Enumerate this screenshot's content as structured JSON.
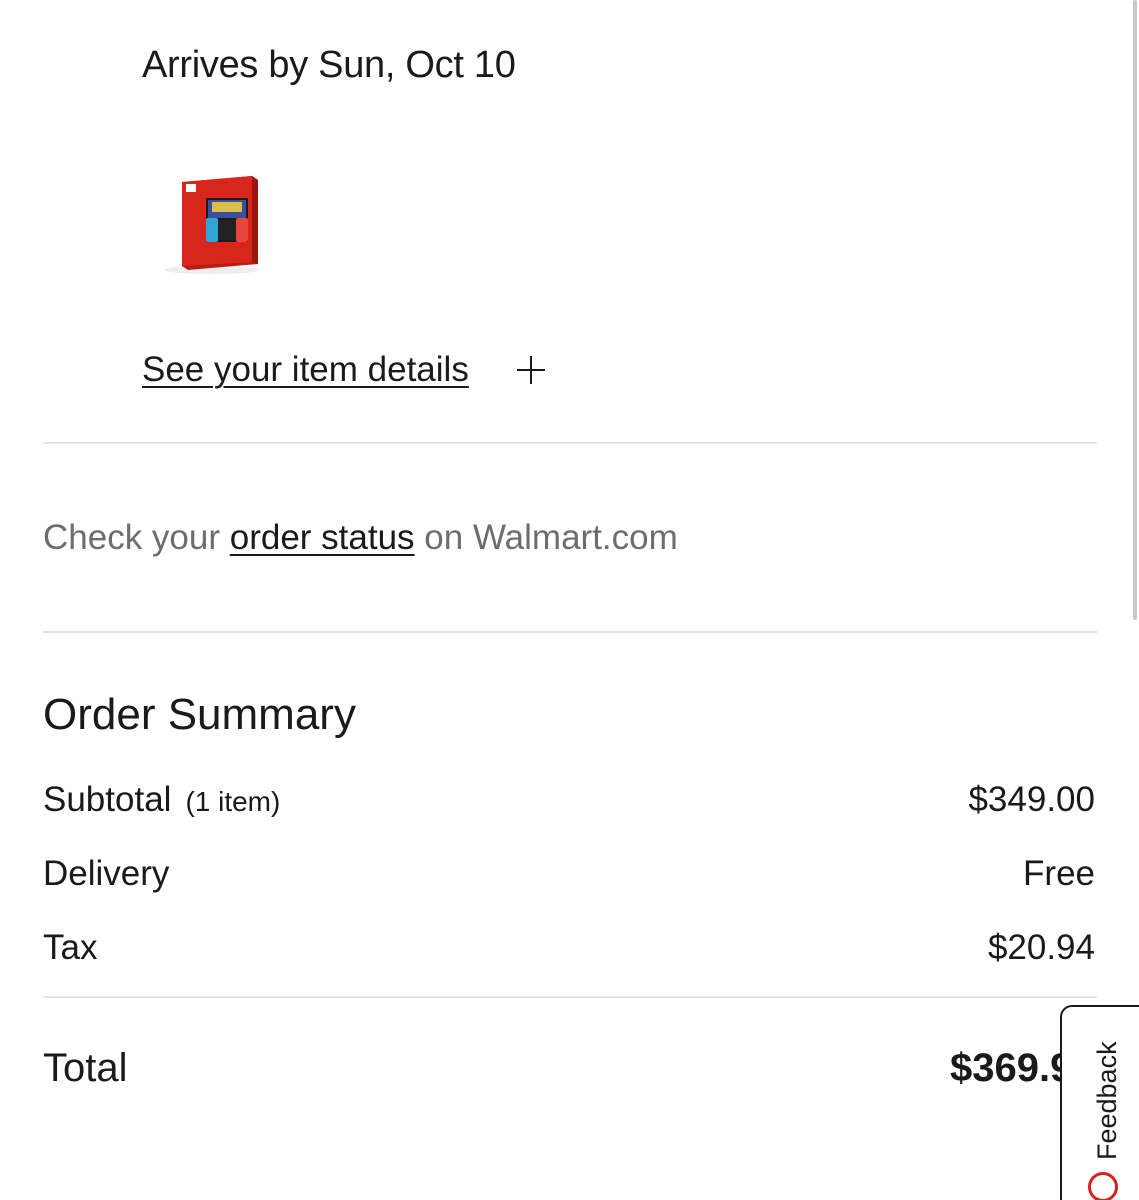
{
  "shipment": {
    "arrival_text": "Arrives by Sun, Oct 10",
    "product_image": "nintendo-switch-box-image",
    "details_link": "See your item details",
    "expand_icon": "plus-icon"
  },
  "status": {
    "prefix": "Check your ",
    "link": "order status",
    "suffix": " on Walmart.com"
  },
  "summary": {
    "title": "Order Summary",
    "subtotal_label": "Subtotal",
    "subtotal_count": "(1 item)",
    "subtotal_value": "$349.00",
    "delivery_label": "Delivery",
    "delivery_value": "Free",
    "tax_label": "Tax",
    "tax_value": "$20.94",
    "total_label": "Total",
    "total_value": "$369.9"
  },
  "feedback": {
    "label": "Feedback",
    "icon": "feedback-circle-icon"
  },
  "colors": {
    "text": "#1a1a1a",
    "muted_text": "#6d6d6d",
    "divider": "#e3e3e3",
    "feedback_accent": "#d6221d",
    "product_red": "#d9261c"
  }
}
